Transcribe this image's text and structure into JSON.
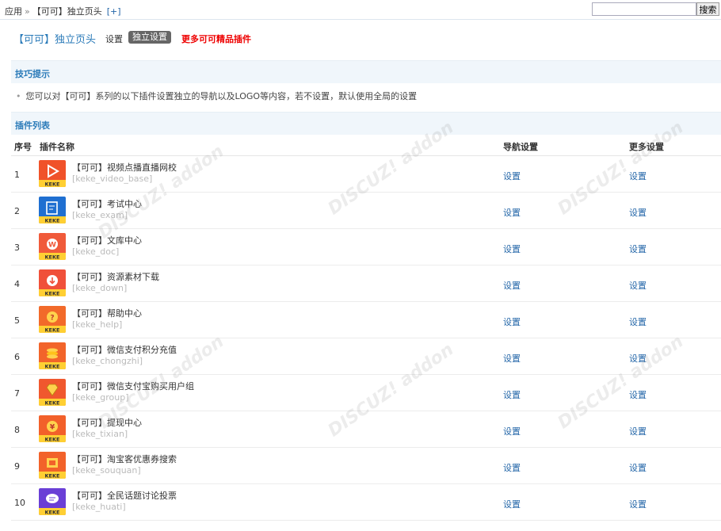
{
  "topbar": {
    "crumb_app": "应用",
    "crumb_sep": "»",
    "crumb_page": "【可可】独立页头",
    "crumb_add": "[+]",
    "search_value": "",
    "search_button": "搜索"
  },
  "header": {
    "title": "【可可】独立页头",
    "tab_settings": "设置",
    "tab_independent": "独立设置",
    "tab_more": "更多可可精品插件"
  },
  "tips": {
    "title": "技巧提示",
    "text": "您可以对【可可】系列的以下插件设置独立的导航以及LOGO等内容，若不设置，默认使用全局的设置"
  },
  "list": {
    "title": "插件列表",
    "columns": {
      "index": "序号",
      "name": "插件名称",
      "nav": "导航设置",
      "more": "更多设置"
    },
    "rows": [
      {
        "index": "1",
        "name": "【可可】视频点播直播网校",
        "id": "[keke_video_base]",
        "nav": "设置",
        "more": "设置",
        "icon": "play-icon",
        "color": "#f0522a"
      },
      {
        "index": "2",
        "name": "【可可】考试中心",
        "id": "[keke_exam]",
        "nav": "设置",
        "more": "设置",
        "icon": "exam-icon",
        "color": "#1f6fd1"
      },
      {
        "index": "3",
        "name": "【可可】文库中心",
        "id": "[keke_doc]",
        "nav": "设置",
        "more": "设置",
        "icon": "doc-w-icon",
        "color": "#f05a3a"
      },
      {
        "index": "4",
        "name": "【可可】资源素材下载",
        "id": "[keke_down]",
        "nav": "设置",
        "more": "设置",
        "icon": "download-icon",
        "color": "#f0503a"
      },
      {
        "index": "5",
        "name": "【可可】帮助中心",
        "id": "[keke_help]",
        "nav": "设置",
        "more": "设置",
        "icon": "help-icon",
        "color": "#f26a2a"
      },
      {
        "index": "6",
        "name": "【可可】微信支付积分充值",
        "id": "[keke_chongzhi]",
        "nav": "设置",
        "more": "设置",
        "icon": "coins-icon",
        "color": "#f2642a"
      },
      {
        "index": "7",
        "name": "【可可】微信支付宝购买用户组",
        "id": "[keke_group]",
        "nav": "设置",
        "more": "设置",
        "icon": "diamond-icon",
        "color": "#f0582e"
      },
      {
        "index": "8",
        "name": "【可可】提现中心",
        "id": "[keke_tixian]",
        "nav": "设置",
        "more": "设置",
        "icon": "yen-icon",
        "color": "#f2602a"
      },
      {
        "index": "9",
        "name": "【可可】淘宝客优惠券搜索",
        "id": "[keke_souquan]",
        "nav": "设置",
        "more": "设置",
        "icon": "coupon-icon",
        "color": "#f2622a"
      },
      {
        "index": "10",
        "name": "【可可】全民话题讨论投票",
        "id": "[keke_huati]",
        "nav": "设置",
        "more": "设置",
        "icon": "chat-icon",
        "color": "#6a3fd6"
      }
    ]
  }
}
